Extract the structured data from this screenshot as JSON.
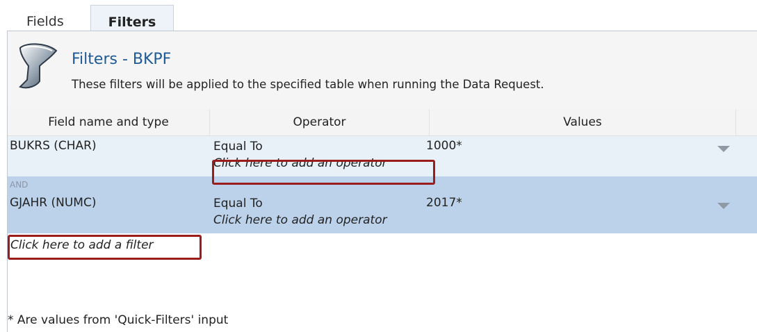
{
  "tabs": [
    {
      "label": "Fields"
    },
    {
      "label": "Filters"
    }
  ],
  "header": {
    "title": "Filters - BKPF",
    "subtitle": "These filters will be applied to the specified table when running the Data Request."
  },
  "grid": {
    "columns": [
      "Field name and type",
      "Operator",
      "Values"
    ],
    "rows": [
      {
        "connector": "",
        "field": "BUKRS   (CHAR)",
        "operator": "Equal To",
        "add_operator": "Click here to add an operator",
        "value": "1000*"
      },
      {
        "connector": "AND",
        "field": "GJAHR   (NUMC)",
        "operator": "Equal To",
        "add_operator": "Click here to add an operator",
        "value": "2017*"
      }
    ],
    "add_filter": "Click here to add a filter"
  },
  "footnote": "* Are values from 'Quick-Filters' input",
  "colors": {
    "accent_title": "#1e5a96",
    "selected_row": "#bcd2ea",
    "row_light": "#e8f0f8",
    "highlight_box": "#9b1c1c"
  },
  "icons": {
    "header_icon": "funnel-icon",
    "row_dropdown": "dropdown-arrow-icon"
  }
}
